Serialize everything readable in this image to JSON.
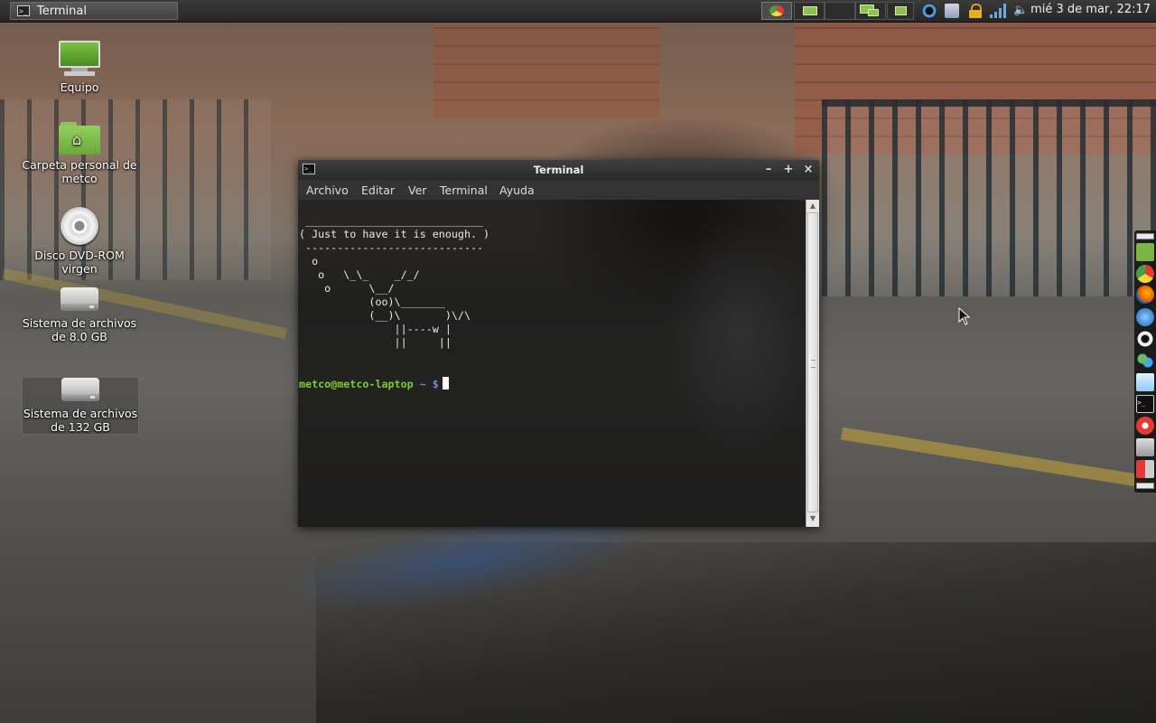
{
  "panel": {
    "task_title": "Terminal",
    "clock": "mié  3 de mar, 22:17"
  },
  "desktop_icons": [
    {
      "label": "Equipo"
    },
    {
      "label": "Carpeta personal de metco"
    },
    {
      "label": "Disco DVD-ROM virgen"
    },
    {
      "label": "Sistema de archivos de 8.0 GB"
    },
    {
      "label": "Sistema de archivos de 132 GB"
    }
  ],
  "terminal": {
    "title": "Terminal",
    "menu": [
      "Archivo",
      "Editar",
      "Ver",
      "Terminal",
      "Ayuda"
    ],
    "output": " ____________________________\n( Just to have it is enough. )\n ----------------------------\n  o\n   o   \\_\\_    _/_/\n    o      \\__/\n           (oo)\\_______\n           (__)\\       )\\/\\\n               ||----w |\n               ||     ||",
    "prompt_user": "metco@metco-laptop",
    "prompt_path": " ~ $"
  },
  "colors": {
    "prompt_user": "#7ccd2a",
    "prompt_path": "#6d8ccf",
    "folder_green": "#8cc45a"
  }
}
